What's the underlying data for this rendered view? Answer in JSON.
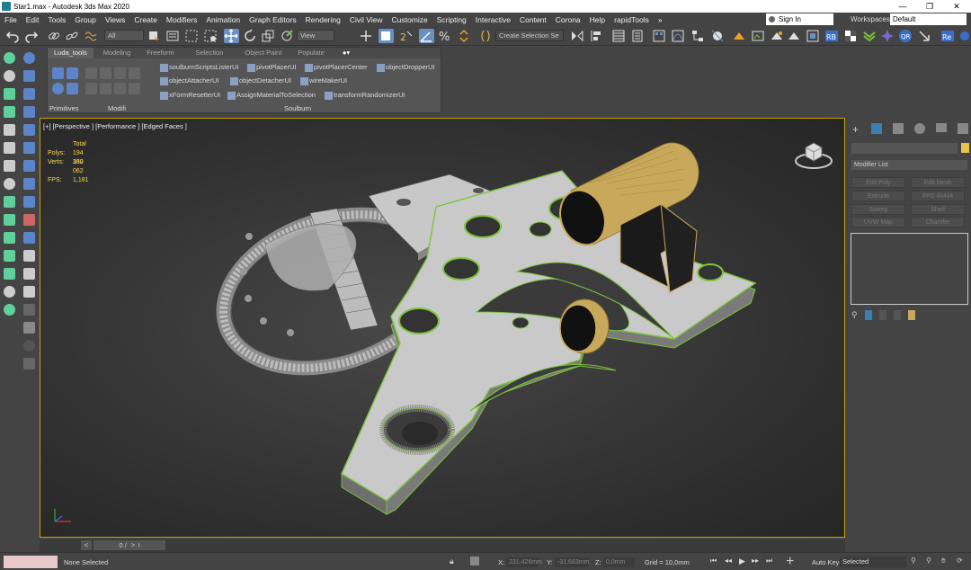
{
  "window": {
    "title": "Star1.max - Autodesk 3ds Max 2020",
    "minimize": "—",
    "maximize": "❐",
    "close": "✕"
  },
  "menu": [
    "File",
    "Edit",
    "Tools",
    "Group",
    "Views",
    "Create",
    "Modifiers",
    "Animation",
    "Graph Editors",
    "Rendering",
    "Civil View",
    "Customize",
    "Scripting",
    "Interactive",
    "Content",
    "Corona",
    "Help",
    "rapidTools",
    "»"
  ],
  "account": {
    "signin": "Sign In",
    "workspaces_label": "Workspaces:",
    "workspace": "Default"
  },
  "toolbar": {
    "filter": "All",
    "view": "View",
    "selection_set": "Create Selection Se"
  },
  "ribbon": {
    "tabs": [
      "Luda_tools",
      "Modeling",
      "Freeform",
      "Selection",
      "Object Paint",
      "Populate"
    ],
    "groups": [
      "Primitives",
      "Modifi",
      "Soulburn"
    ],
    "scripts": [
      "soulburnScriptsListerUI",
      "pivotPlacerUI",
      "pivotPlacerCenter",
      "objectDropperUI",
      "objectAttacherUI",
      "objectDetacherUI",
      "wireMakerUI",
      "xFormResetterUI",
      "AssignMaterialToSelection",
      "transformRandomizerUI"
    ]
  },
  "viewport": {
    "label": "[+] [Perspective ] [Performance ] [Edged Faces ]",
    "stats": {
      "total_label": "Total",
      "polys_label": "Polys:",
      "polys": "194 330",
      "verts_label": "Verts:",
      "verts": "162 062",
      "fps_label": "FPS:",
      "fps": "1,181"
    }
  },
  "command_panel": {
    "modifier_list": "Modifier List",
    "buttons": [
      "Edit Poly",
      "Edit Mesh",
      "Extrude",
      "FFD 4x4x4",
      "Sweep",
      "Shell",
      "UVW Map",
      "Chamfer"
    ]
  },
  "timeline": {
    "frame": "0 / 100",
    "prev": "<",
    "next": ">"
  },
  "status": {
    "selection": "None Selected",
    "x_label": "X:",
    "x": "231,426mm",
    "y_label": "Y:",
    "y": "-31,683mm",
    "z_label": "Z:",
    "z": "0,0mm",
    "grid": "Grid = 10,0mm",
    "autokey": "Auto Key",
    "key_filter": "Selected"
  },
  "colors": {
    "accent": "#6a8fc2",
    "viewport_border": "#c8a200",
    "edge_green": "#7dc43c",
    "brass": "#c8a85a"
  }
}
